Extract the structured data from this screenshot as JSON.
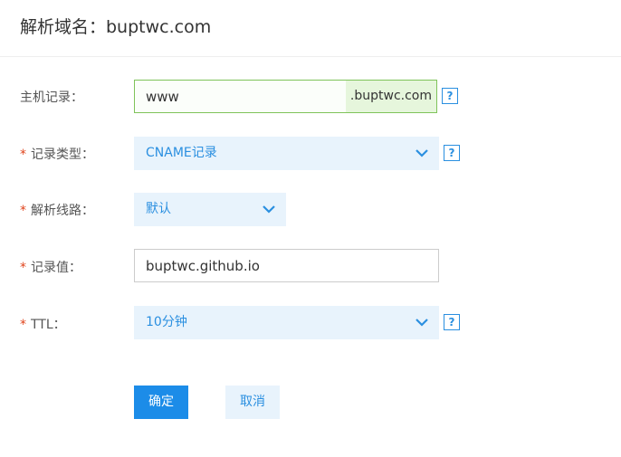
{
  "header": {
    "title": "解析域名：buptwc.com"
  },
  "form": {
    "host": {
      "label": "主机记录：",
      "value": "www",
      "suffix": ".buptwc.com",
      "help": "?"
    },
    "record_type": {
      "required": "*",
      "label": "记录类型：",
      "value": "CNAME记录",
      "help": "?"
    },
    "line": {
      "required": "*",
      "label": "解析线路：",
      "value": "默认"
    },
    "record_value": {
      "required": "*",
      "label": "记录值：",
      "value": "buptwc.github.io"
    },
    "ttl": {
      "required": "*",
      "label": "TTL：",
      "value": "10分钟",
      "help": "?"
    }
  },
  "buttons": {
    "confirm": "确定",
    "cancel": "取消"
  },
  "icons": {
    "dropdown": "chevron-down-icon",
    "help": "question-mark-icon"
  },
  "colors": {
    "accent": "#1c8ce8",
    "select_bg": "#e8f3fc",
    "focus_border": "#7fc35a",
    "required": "#e0441c"
  }
}
